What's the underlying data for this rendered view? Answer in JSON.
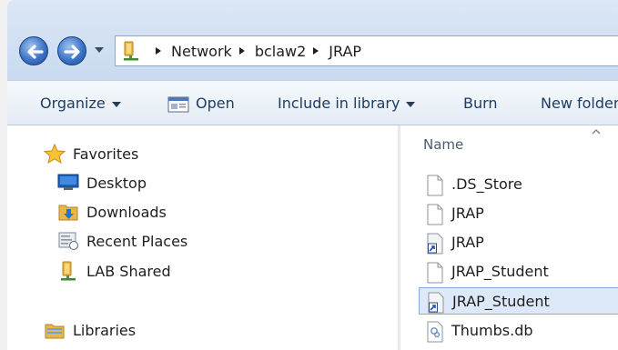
{
  "address_bar": {
    "breadcrumbs": [
      "Network",
      "bclaw2",
      "JRAP"
    ],
    "location_icon": "network-folder-icon"
  },
  "navigation": {
    "back_icon": "back-arrow-icon",
    "forward_icon": "forward-arrow-icon",
    "history_icon": "chevron-down-icon"
  },
  "toolbar": {
    "organize": "Organize",
    "open": "Open",
    "include_in_library": "Include in library",
    "burn": "Burn",
    "new_folder": "New folder"
  },
  "nav_pane": {
    "favorites": {
      "label": "Favorites",
      "items": [
        {
          "label": "Desktop",
          "icon": "desktop-icon"
        },
        {
          "label": "Downloads",
          "icon": "downloads-icon"
        },
        {
          "label": "Recent Places",
          "icon": "recent-places-icon"
        },
        {
          "label": "LAB Shared",
          "icon": "network-folder-icon"
        }
      ]
    },
    "libraries": {
      "label": "Libraries"
    }
  },
  "file_list": {
    "column_name": "Name",
    "files": [
      {
        "name": ".DS_Store",
        "icon": "file-icon",
        "selected": false
      },
      {
        "name": "JRAP",
        "icon": "file-icon",
        "selected": false
      },
      {
        "name": "JRAP",
        "icon": "shortcut-icon",
        "selected": false
      },
      {
        "name": "JRAP_Student",
        "icon": "file-icon",
        "selected": false
      },
      {
        "name": "JRAP_Student",
        "icon": "shortcut-icon",
        "selected": true
      },
      {
        "name": "Thumbs.db",
        "icon": "thumbs-db-icon",
        "selected": false
      }
    ]
  },
  "colors": {
    "accent": "#3d74c7",
    "selection": "#dde9f8",
    "selection_border": "#84acdd",
    "toolbar_text": "#1e3d63"
  }
}
